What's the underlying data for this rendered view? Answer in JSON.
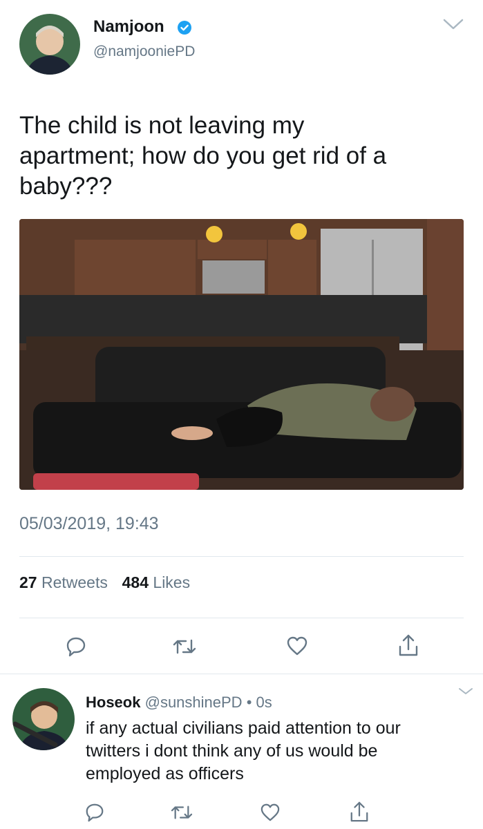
{
  "tweet": {
    "display_name": "Namjoon",
    "handle": "@namjooniePD",
    "text_lines": [
      "The child is not leaving my",
      "apartment; how do you get rid of a",
      "baby???"
    ],
    "timestamp": "05/03/2019, 19:43",
    "stats": {
      "retweets_count": "27",
      "retweets_label": "Retweets",
      "likes_count": "484",
      "likes_label": "Likes"
    }
  },
  "reply": {
    "display_name": "Hoseok",
    "handle": "@sunshinePD",
    "separator": "•",
    "time": "0s",
    "text_lines": [
      "if any actual civilians paid attention to our",
      "twitters i dont think any of us would be",
      "employed as officers"
    ]
  },
  "icons": {
    "verified": "verified-badge-icon",
    "chevron": "chevron-down-icon",
    "reply": "reply-icon",
    "retweet": "retweet-icon",
    "like": "heart-icon",
    "share": "share-icon"
  },
  "colors": {
    "verified": "#1da1f2",
    "text": "#14171a",
    "muted": "#657786",
    "divider": "#e1e8ed"
  }
}
